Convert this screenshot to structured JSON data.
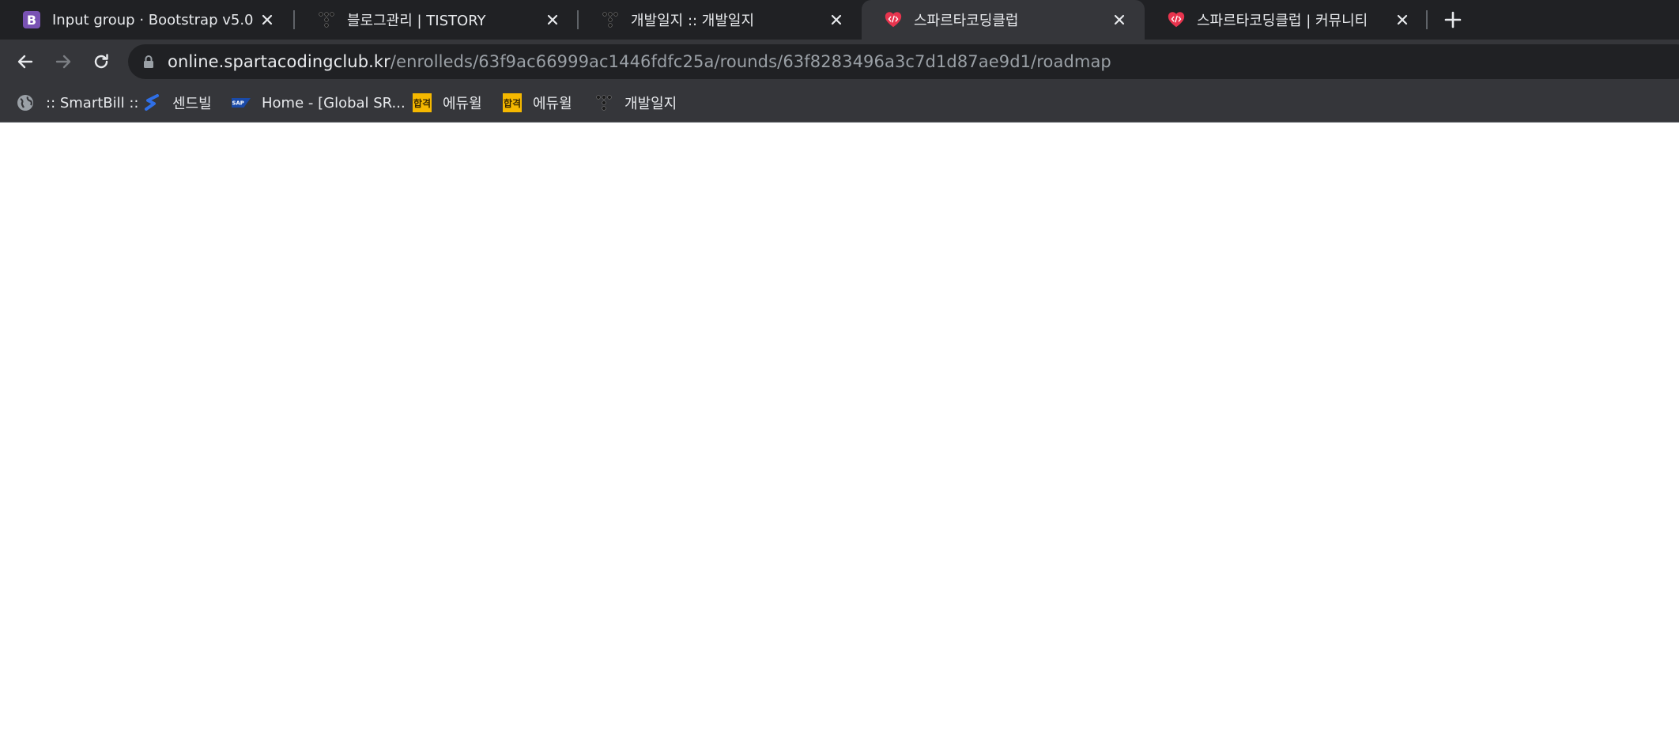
{
  "tabs": [
    {
      "title": "Input group · Bootstrap v5.0",
      "icon": "bootstrap-icon"
    },
    {
      "title": "블로그관리 | TISTORY",
      "icon": "tistory-icon"
    },
    {
      "title": "개발일지 :: 개발일지",
      "icon": "tistory-icon"
    },
    {
      "title": "스파르타코딩클럽",
      "icon": "sparta-icon",
      "active": true
    },
    {
      "title": "스파르타코딩클럽 | 커뮤니티",
      "icon": "sparta-icon"
    }
  ],
  "address": {
    "host": "online.spartacodingclub.kr",
    "path": "/enrolleds/63f9ac66999ac1446fdfc25a/rounds/63f8283496a3c7d1d87ae9d1/roadmap"
  },
  "bookmarks": [
    {
      "label": ":: SmartBill ::",
      "icon": "globe-icon"
    },
    {
      "label": "센드빌",
      "icon": "sendbill-icon"
    },
    {
      "label": "Home - [Global SR...",
      "icon": "sap-icon"
    },
    {
      "label": "에듀윌",
      "icon": "eduwill-icon"
    },
    {
      "label": "에듀윌",
      "icon": "eduwill-icon"
    },
    {
      "label": "개발일지",
      "icon": "tistory-icon"
    }
  ],
  "colors": {
    "frame": "#202124",
    "toolbar": "#35363a",
    "text": "#e8eaed",
    "muted": "#9aa0a6",
    "sparta_red": "#e8344e",
    "bootstrap_purple": "#7952b3"
  }
}
